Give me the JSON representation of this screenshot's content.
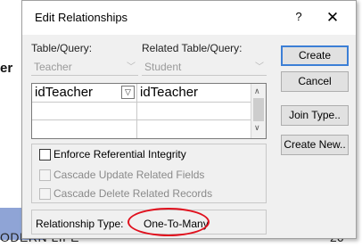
{
  "background": {
    "left_fragment": "er",
    "bottom_text": "ODERN LIFE",
    "page_number": "26"
  },
  "dialog": {
    "title": "Edit Relationships",
    "help_button": "?",
    "close_button": "✕",
    "table_label": "Table/Query:",
    "related_label": "Related Table/Query:",
    "table_value": "Teacher",
    "related_value": "Student",
    "grid_rows": [
      {
        "left": "idTeacher",
        "right": "idTeacher"
      },
      {
        "left": "",
        "right": ""
      },
      {
        "left": "",
        "right": ""
      }
    ],
    "buttons": {
      "create": "Create",
      "cancel": "Cancel",
      "join_type": "Join Type..",
      "create_new": "Create New.."
    },
    "enforce_label": "Enforce Referential Integrity",
    "enforce_checked": false,
    "cascade_update_label": "Cascade Update Related Fields",
    "cascade_delete_label": "Cascade Delete Related Records",
    "relationship_type_label": "Relationship Type:",
    "relationship_type_value": "One-To-Many"
  },
  "annotation_color": "#e0101d",
  "accent_color": "#3c7fd6"
}
